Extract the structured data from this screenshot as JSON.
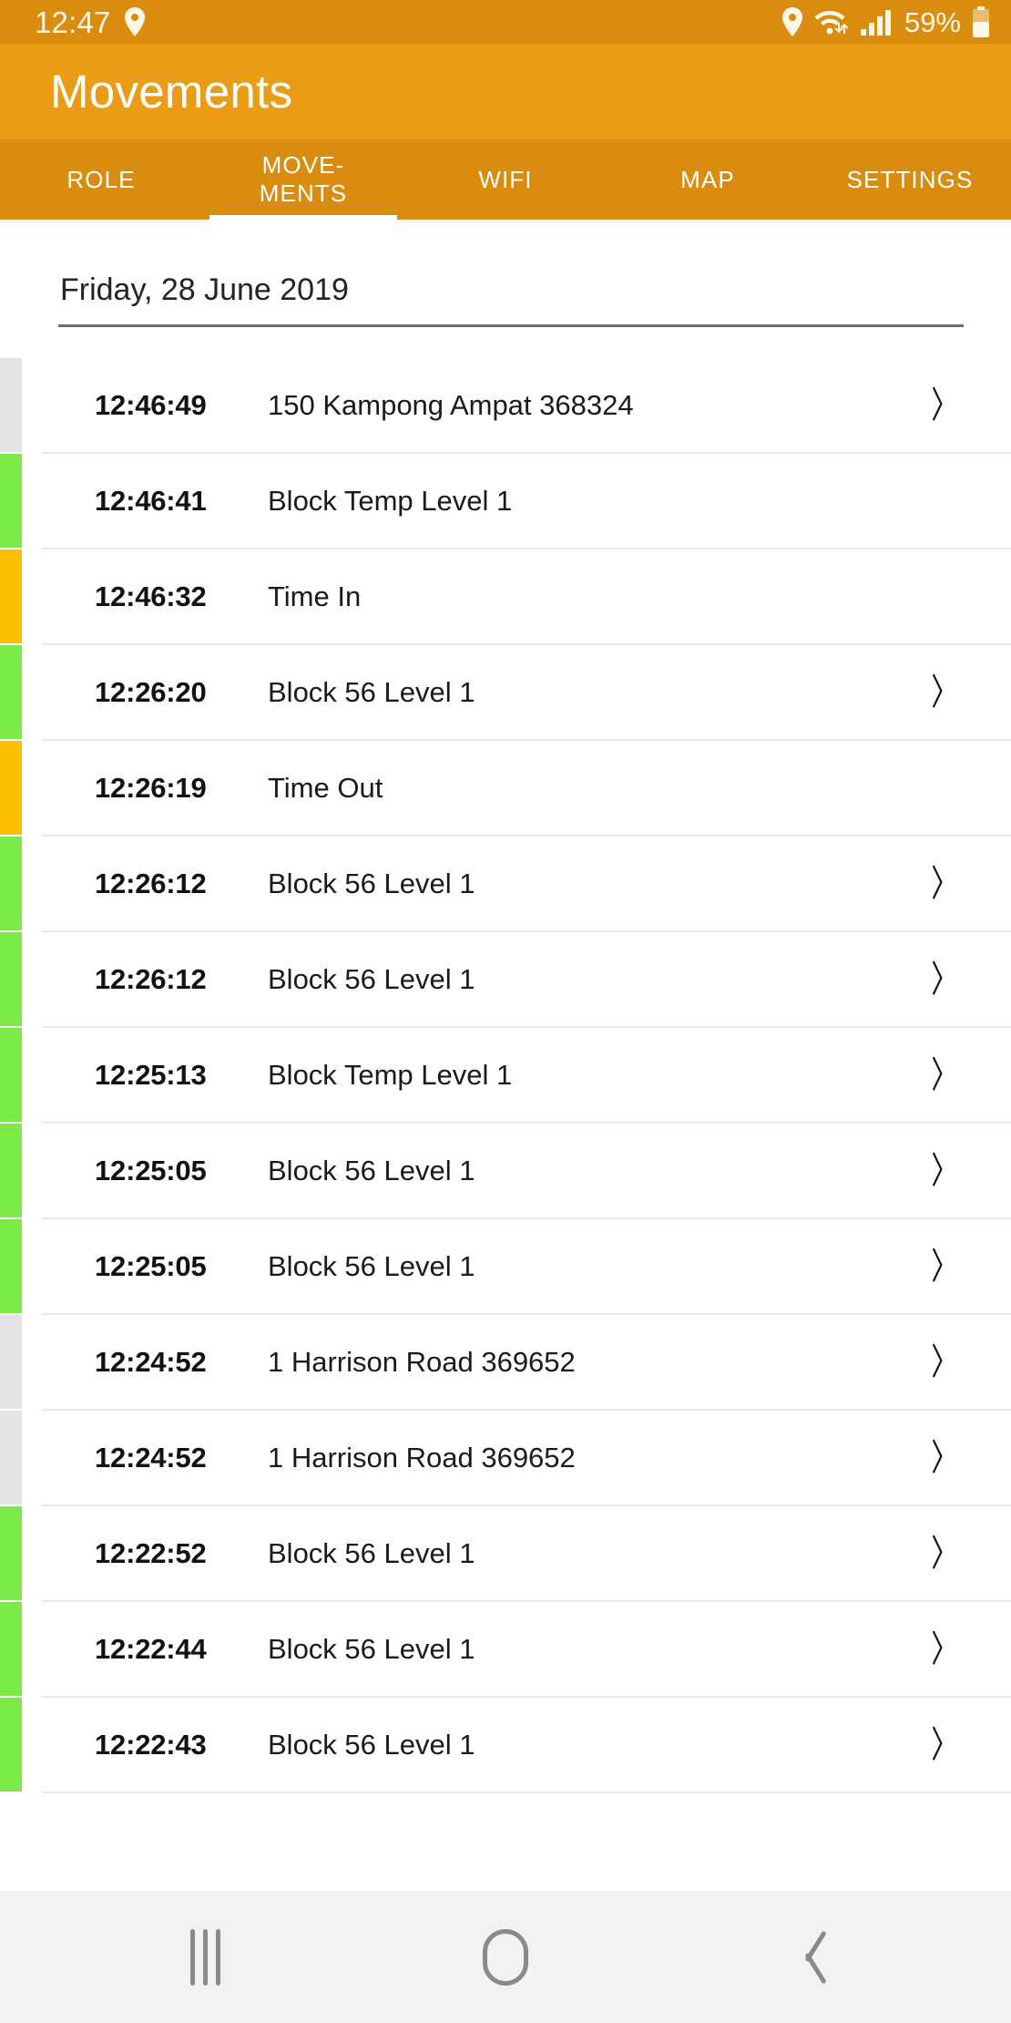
{
  "status_bar": {
    "time": "12:47",
    "battery_percent": "59%",
    "icons": {
      "location": "location-pin-icon",
      "wifi": "wifi-icon",
      "signal": "cellular-signal-icon",
      "battery": "battery-icon"
    }
  },
  "app_bar": {
    "title": "Movements"
  },
  "tabs": {
    "active_index": 1,
    "items": [
      {
        "label": "ROLE"
      },
      {
        "label": "MOVE-\nMENTS"
      },
      {
        "label": "WIFI"
      },
      {
        "label": "MAP"
      },
      {
        "label": "SETTINGS"
      }
    ]
  },
  "colors": {
    "app_bar": "#EB9C16",
    "tab_bar": "#D98C0D",
    "marker_green": "#7CEB4A",
    "marker_amber": "#FBBE00",
    "marker_grey": "#E3E3E3",
    "divider": "#E9E9E9",
    "date_rule": "#6F6F6F",
    "nav_bar": "#F2F2F2"
  },
  "main": {
    "date_header": "Friday, 28 June 2019",
    "chevron_glyph": "〉",
    "rows": [
      {
        "time": "12:46:49",
        "label": "150 Kampong Ampat 368324",
        "marker": "grey",
        "chevron": true
      },
      {
        "time": "12:46:41",
        "label": "Block Temp Level 1",
        "marker": "green",
        "chevron": false
      },
      {
        "time": "12:46:32",
        "label": "Time In",
        "marker": "amber",
        "chevron": false
      },
      {
        "time": "12:26:20",
        "label": "Block 56 Level 1",
        "marker": "green",
        "chevron": true
      },
      {
        "time": "12:26:19",
        "label": "Time Out",
        "marker": "amber",
        "chevron": false
      },
      {
        "time": "12:26:12",
        "label": "Block 56 Level 1",
        "marker": "green",
        "chevron": true
      },
      {
        "time": "12:26:12",
        "label": "Block 56 Level 1",
        "marker": "green",
        "chevron": true
      },
      {
        "time": "12:25:13",
        "label": "Block Temp Level 1",
        "marker": "green",
        "chevron": true
      },
      {
        "time": "12:25:05",
        "label": "Block 56 Level 1",
        "marker": "green",
        "chevron": true
      },
      {
        "time": "12:25:05",
        "label": "Block 56 Level 1",
        "marker": "green",
        "chevron": true
      },
      {
        "time": "12:24:52",
        "label": "1 Harrison Road 369652",
        "marker": "grey",
        "chevron": true
      },
      {
        "time": "12:24:52",
        "label": "1 Harrison Road 369652",
        "marker": "grey",
        "chevron": true
      },
      {
        "time": "12:22:52",
        "label": "Block 56 Level 1",
        "marker": "green",
        "chevron": true
      },
      {
        "time": "12:22:44",
        "label": "Block 56 Level 1",
        "marker": "green",
        "chevron": true
      },
      {
        "time": "12:22:43",
        "label": "Block 56 Level 1",
        "marker": "green",
        "chevron": true
      }
    ]
  },
  "nav_bar": {
    "recents_label": "recents-icon",
    "home_label": "home-icon",
    "back_label": "back-icon"
  }
}
